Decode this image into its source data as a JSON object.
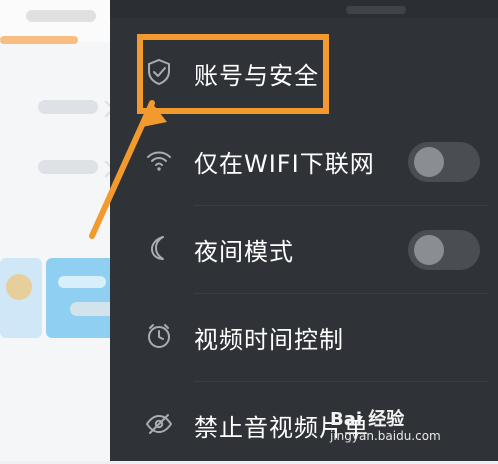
{
  "drawer": {
    "items": [
      {
        "label": "账号与安全",
        "icon": "shield-check-icon",
        "has_toggle": false
      },
      {
        "label": "仅在WIFI下联网",
        "icon": "wifi-icon",
        "has_toggle": true,
        "toggle_on": false
      },
      {
        "label": "夜间模式",
        "icon": "moon-icon",
        "has_toggle": true,
        "toggle_on": false
      },
      {
        "label": "视频时间控制",
        "icon": "alarm-clock-icon",
        "has_toggle": false
      },
      {
        "label": "禁止音视频片单",
        "icon": "eye-off-icon",
        "has_toggle": false
      }
    ]
  },
  "watermark": {
    "brand": "Bai 经验",
    "url": "jingyan.baidu.com"
  },
  "colors": {
    "drawer_bg": "#2f3237",
    "highlight": "#f29a2e",
    "text": "#ffffff"
  }
}
